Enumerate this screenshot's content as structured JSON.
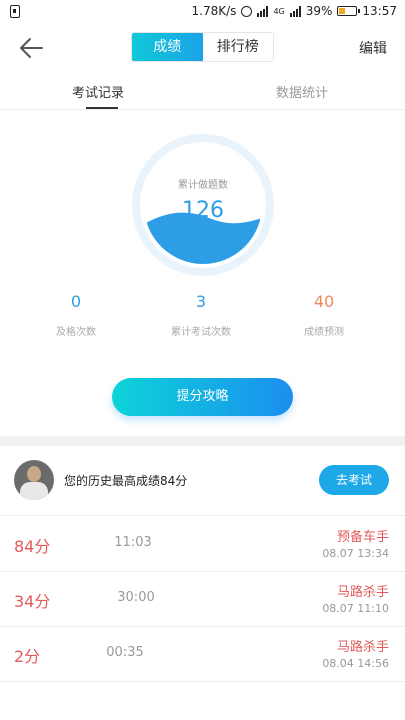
{
  "status": {
    "speed": "1.78K/s",
    "network": "4G",
    "battery": "39%",
    "time": "13:57"
  },
  "nav": {
    "seg_active": "成绩",
    "seg_inactive": "排行榜",
    "edit": "编辑"
  },
  "tabs": [
    {
      "label": "考试记录",
      "active": true
    },
    {
      "label": "数据统计",
      "active": false
    }
  ],
  "gauge": {
    "label": "累计做题数",
    "value": "126"
  },
  "stats": [
    {
      "value": "0",
      "label": "及格次数"
    },
    {
      "value": "3",
      "label": "累计考试次数"
    },
    {
      "value": "40",
      "label": "成绩预测"
    }
  ],
  "cta": "提分攻略",
  "profile": {
    "text": "您的历史最高成绩84分",
    "button": "去考试"
  },
  "records": [
    {
      "score": "84分",
      "duration": "11:03",
      "rank": "预备车手",
      "date": "08.07  13:34"
    },
    {
      "score": "34分",
      "duration": "30:00",
      "rank": "马路杀手",
      "date": "08.07  11:10"
    },
    {
      "score": "2分",
      "duration": "00:35",
      "rank": "马路杀手",
      "date": "08.04  14:56"
    }
  ],
  "colors": {
    "accent": "#1aa3e8",
    "score_red": "#e35b5b",
    "stat_orange": "#f08a5d"
  }
}
